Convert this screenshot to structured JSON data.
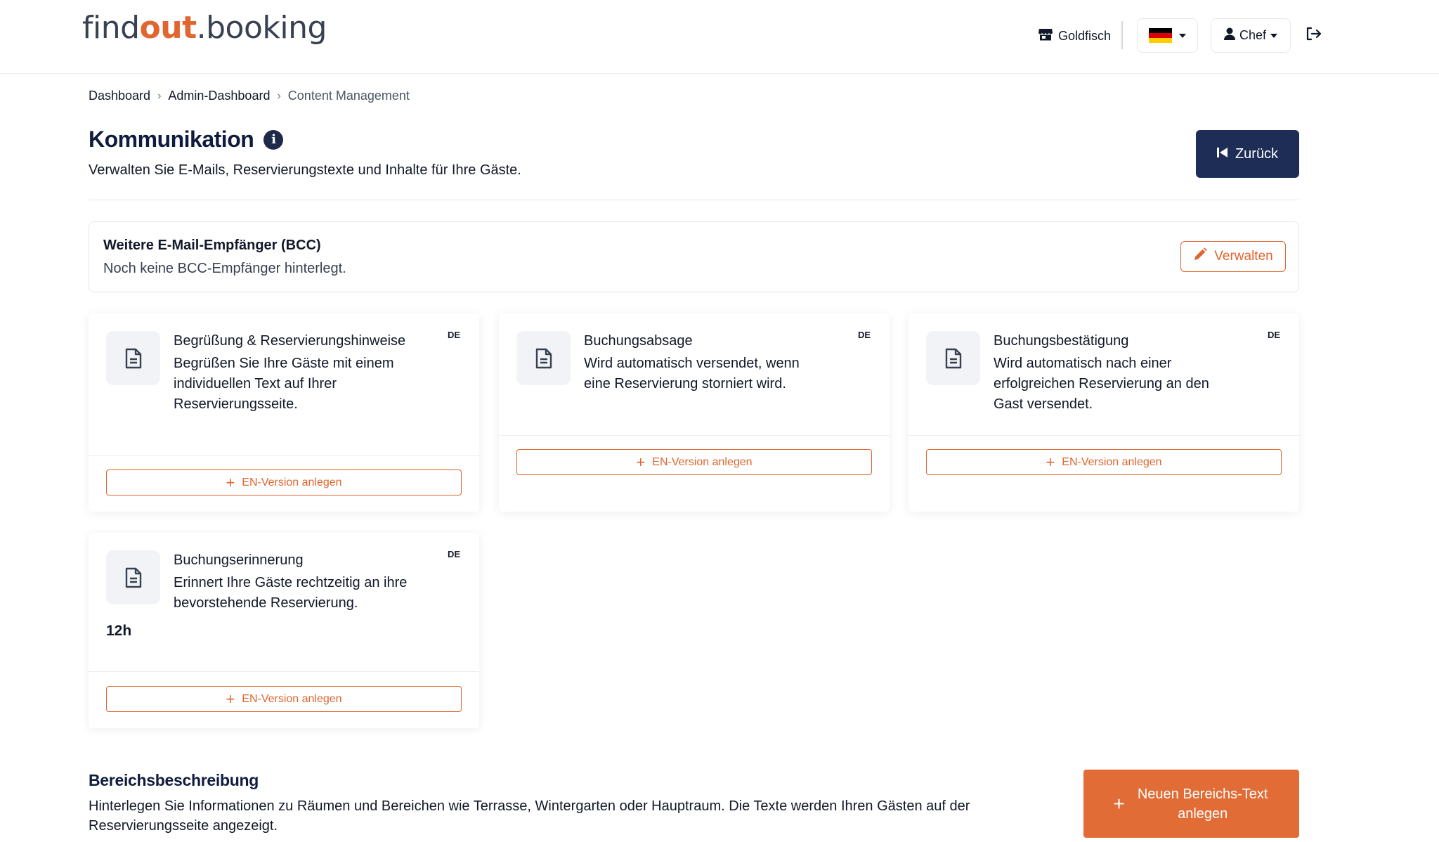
{
  "brand": {
    "logo_part1": "find",
    "logo_part2": "out",
    "logo_part3": ".booking",
    "accent_color": "#e0652f",
    "navy_color": "#1d2d55"
  },
  "header": {
    "restaurant_name": "Goldfisch",
    "language_flag": "de-flag-icon",
    "user_label": "Chef"
  },
  "breadcrumb": {
    "items": [
      "Dashboard",
      "Admin-Dashboard"
    ],
    "current": "Content Management"
  },
  "page": {
    "title": "Kommunikation",
    "subtitle": "Verwalten Sie E-Mails, Reservierungstexte und Inhalte für Ihre Gäste.",
    "back_label": "Zurück"
  },
  "bcc": {
    "title": "Weitere E-Mail-Empfänger (BCC)",
    "description": "Noch keine BCC-Empfänger hinterlegt.",
    "manage_label": "Verwalten"
  },
  "templates": [
    {
      "title": "Begrüßung & Reservierungshinweise",
      "description": "Begrüßen Sie Ihre Gäste mit einem individuellen Text auf Ihrer Reservierungsseite.",
      "lang": "DE",
      "action": "EN-Version anlegen"
    },
    {
      "title": "Buchungsabsage",
      "description": "Wird automatisch versendet, wenn eine Reservierung storniert wird.",
      "lang": "DE",
      "action": "EN-Version anlegen"
    },
    {
      "title": "Buchungsbestätigung",
      "description": "Wird automatisch nach einer erfolgreichen Reservierung an den Gast versendet.",
      "lang": "DE",
      "action": "EN-Version anlegen"
    },
    {
      "title": "Buchungserinnerung",
      "description": "Erinnert Ihre Gäste rechtzeitig an ihre bevorstehende Reservierung.",
      "lang": "DE",
      "extra_value": "12h",
      "action": "EN-Version anlegen"
    }
  ],
  "area_section": {
    "title": "Bereichsbeschreibung",
    "description": "Hinterlegen Sie Informationen zu Räumen und Bereichen wie Terrasse, Wintergarten oder Hauptraum. Die Texte werden Ihren Gästen auf der Reservierungsseite angezeigt.",
    "button_label": "Neuen Bereichs-Text anlegen"
  }
}
